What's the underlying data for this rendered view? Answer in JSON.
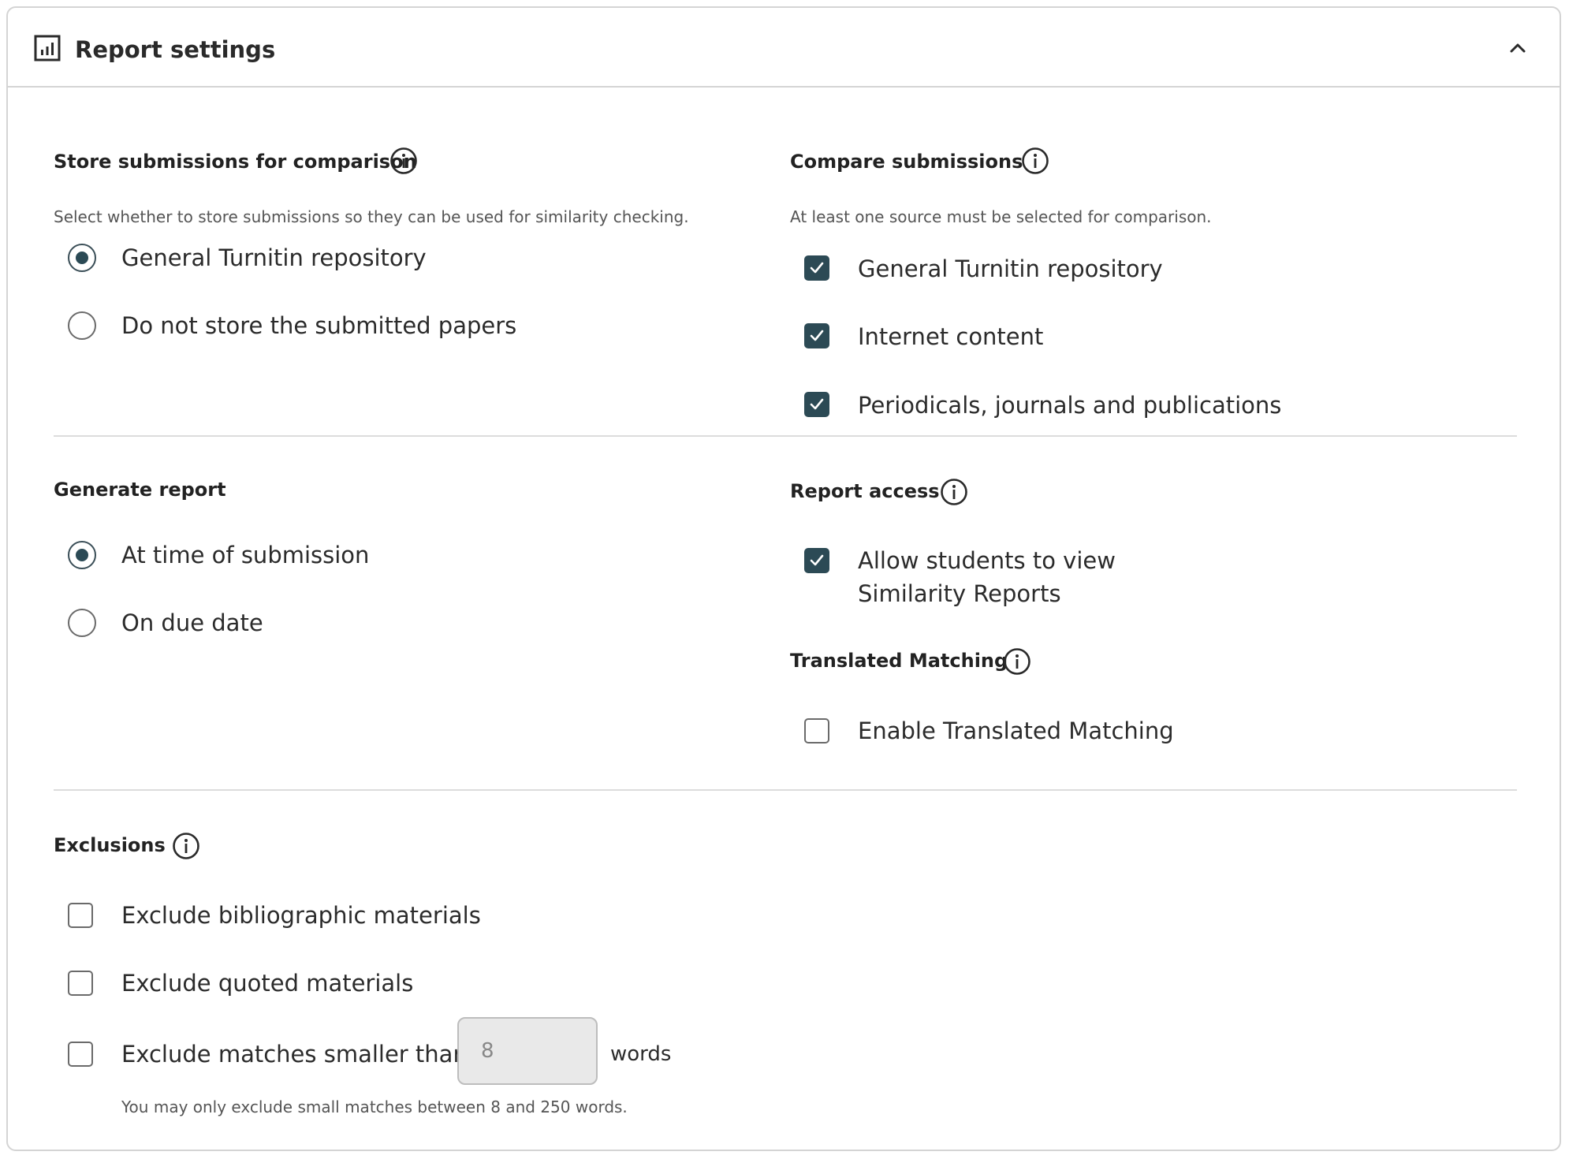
{
  "header": {
    "title": "Report settings",
    "icon": "bar-chart-icon",
    "collapse_icon": "chevron-up-icon"
  },
  "store": {
    "title": "Store submissions for comparison",
    "helper": "Select whether to store submissions so they can be used for similarity checking.",
    "options": [
      {
        "label": "General Turnitin repository",
        "selected": true
      },
      {
        "label": "Do not store the submitted papers",
        "selected": false
      }
    ]
  },
  "compare": {
    "title": "Compare submissions",
    "helper": "At least one source must be selected for comparison.",
    "options": [
      {
        "label": "General Turnitin repository",
        "checked": true
      },
      {
        "label": "Internet content",
        "checked": true
      },
      {
        "label": "Periodicals, journals and publications",
        "checked": true
      }
    ]
  },
  "generate": {
    "title": "Generate report",
    "options": [
      {
        "label": "At time of submission",
        "selected": true
      },
      {
        "label": "On due date",
        "selected": false
      }
    ]
  },
  "access": {
    "title": "Report access",
    "option_line1": "Allow students to view",
    "option_line2": "Similarity Reports",
    "checked": true
  },
  "translated": {
    "title": "Translated Matching",
    "option": "Enable Translated Matching",
    "checked": false
  },
  "exclusions": {
    "title": "Exclusions",
    "options": [
      {
        "label": "Exclude bibliographic materials",
        "checked": false
      },
      {
        "label": "Exclude quoted materials",
        "checked": false
      },
      {
        "label": "Exclude matches smaller than",
        "checked": false
      }
    ],
    "words_value": "8",
    "words_suffix": "words",
    "helper": "You may only exclude small matches between 8 and 250 words."
  },
  "colors": {
    "accent": "#2c4a55",
    "border": "#d4d4d4",
    "divider": "#dcdcdc",
    "input_bg": "#e9e9e9"
  }
}
